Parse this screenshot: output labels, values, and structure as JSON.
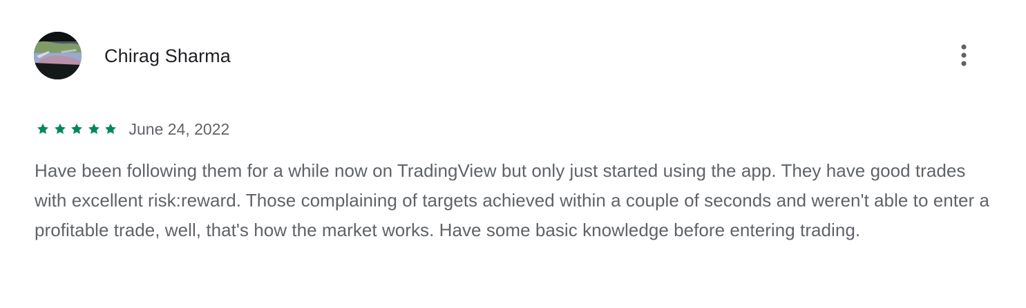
{
  "review": {
    "reviewer_name": "Chirag Sharma",
    "avatar_icon": "profile-photo-avatar",
    "more_options_icon": "more-vertical-icon",
    "rating": 5,
    "rating_max": 5,
    "star_icon": "star-icon",
    "date": "June 24, 2022",
    "text": "Have been following them for a while now on TradingView but only just started using the app. They have good trades with excellent risk:reward. Those complaining of targets achieved within a couple of seconds and weren't able to enter a profitable trade, well, that's how the market works. Have some basic knowledge before entering trading."
  },
  "colors": {
    "star": "#01875f",
    "name": "#202124",
    "date": "#5f6368",
    "body": "#5f6368",
    "more_icon": "#5f6368",
    "background": "#ffffff"
  }
}
